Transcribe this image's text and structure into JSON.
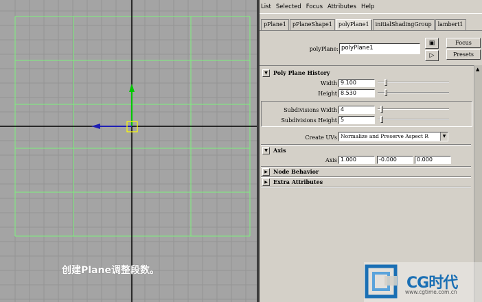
{
  "viewport": {
    "caption": "创建Plane调整段数。"
  },
  "menubar": {
    "items": [
      "List",
      "Selected",
      "Focus",
      "Attributes",
      "Help"
    ]
  },
  "tabs": [
    {
      "label": "pPlane1",
      "active": false
    },
    {
      "label": "pPlaneShape1",
      "active": false
    },
    {
      "label": "polyPlane1",
      "active": true
    },
    {
      "label": "initialShadingGroup",
      "active": false
    },
    {
      "label": "lambert1",
      "active": false
    }
  ],
  "node": {
    "label": "polyPlane:",
    "value": "polyPlane1"
  },
  "buttons": {
    "focus": "Focus",
    "presets": "Presets"
  },
  "sections": {
    "history": {
      "title": "Poly Plane History",
      "width_label": "Width",
      "width_value": "9.100",
      "height_label": "Height",
      "height_value": "8.530",
      "subdiv_w_label": "Subdivisions Width",
      "subdiv_w_value": "4",
      "subdiv_h_label": "Subdivisions Height",
      "subdiv_h_value": "5",
      "create_uvs_label": "Create UVs",
      "create_uvs_value": "Normalize and Preserve Aspect R"
    },
    "axis": {
      "title": "Axis",
      "axis_label": "Axis",
      "x": "1.000",
      "y": "-0.000",
      "z": "0.000"
    },
    "node_behavior": {
      "title": "Node Behavior"
    },
    "extra": {
      "title": "Extra Attributes"
    }
  },
  "logo": {
    "text": "CG时代",
    "url": "www.cgtime.com.cn"
  },
  "colors": {
    "viewport_bg": "#a4a4a4",
    "grid_line": "#949494",
    "plane_wire": "#7cf27c",
    "axis_line": "#000000",
    "manip_y": "#00c800",
    "manip_x": "#1e1eb4",
    "manip_center": "#ffff00",
    "logo_blue": "#1a6fb4"
  }
}
